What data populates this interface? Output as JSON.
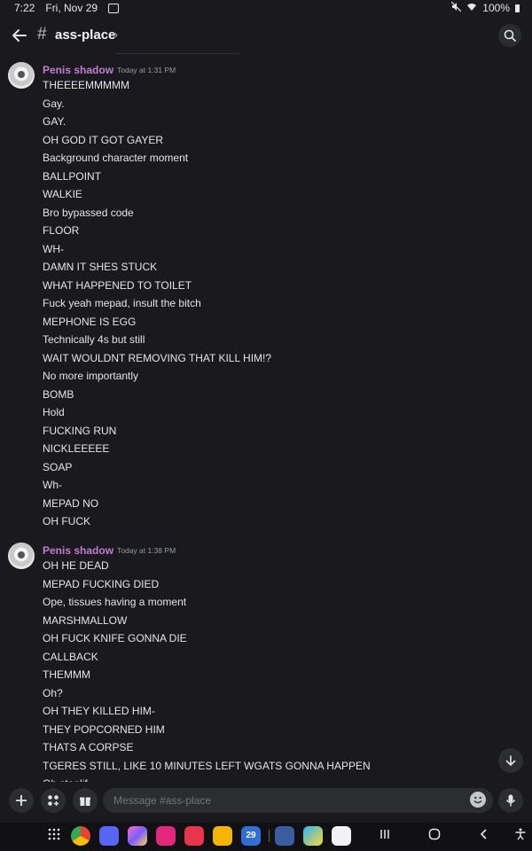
{
  "status_bar": {
    "time": "7:22",
    "date": "Fri, Nov 29",
    "battery": "100%"
  },
  "header": {
    "channel_name": "ass-place"
  },
  "composer": {
    "placeholder": "Message #ass-place"
  },
  "calendar_day": "29",
  "colors": {
    "background": "#1a1a1e",
    "author": "#c37ad8",
    "surface": "#2b2d31"
  },
  "messages": [
    {
      "author": "Penis shadow",
      "timestamp": "Today at 1:31 PM",
      "lines": [
        "THEEEEMMMMM",
        "Gay.",
        "GAY.",
        "OH GOD IT GOT GAYER",
        "Background character moment",
        "BALLPOINT",
        "WALKIE",
        "Bro bypassed code",
        "FLOOR",
        "WH-",
        "DAMN IT SHES STUCK",
        "WHAT HAPPENED TO TOILET",
        "Fuck yeah mepad, insult the bitch",
        "MEPHONE IS EGG",
        "Technically 4s but still",
        "WAIT WOULDNT REMOVING THAT KILL HIM!?",
        "No more importantly",
        "BOMB",
        "Hold",
        "FUCKING RUN",
        "NICKLEEEEE",
        "SOAP",
        "Wh-",
        "MEPAD NO",
        "OH FUCK"
      ]
    },
    {
      "author": "Penis shadow",
      "timestamp": "Today at 1:38 PM",
      "lines": [
        "OH HE DEAD",
        "MEPAD FUCKING DIED",
        "Ope, tissues having a moment",
        "MARSHMALLOW",
        "OH FUCK KNIFE GONNA DIE",
        "CALLBACK",
        "THEMMM",
        "Oh?",
        "OH THEY KILLED HIM-",
        "THEY POPCORNED HIM",
        "THATS A CORPSE",
        "TGERES STILL, LIKE 10 MINUTES LEFT WGATS GONNA HAPPEN",
        "Oh stoolif"
      ]
    }
  ]
}
